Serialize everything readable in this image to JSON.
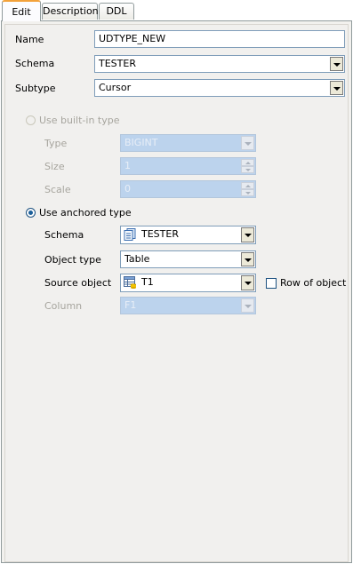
{
  "tabs": [
    {
      "label": "Edit"
    },
    {
      "label": "Description"
    },
    {
      "label": "DDL"
    }
  ],
  "general": {
    "name_label": "Name",
    "name_value": "UDTYPE_NEW",
    "schema_label": "Schema",
    "schema_value": "TESTER",
    "subtype_label": "Subtype",
    "subtype_value": "Cursor"
  },
  "builtin": {
    "radio_label": "Use built-in type",
    "type_label": "Type",
    "type_value": "BIGINT",
    "size_label": "Size",
    "size_value": "1",
    "scale_label": "Scale",
    "scale_value": "0"
  },
  "anchored": {
    "radio_label": "Use anchored type",
    "schema_label": "Schema",
    "schema_value": "TESTER",
    "object_type_label": "Object type",
    "object_type_value": "Table",
    "source_object_label": "Source object",
    "source_object_value": "T1",
    "row_of_object_label": "Row of object",
    "column_label": "Column",
    "column_value": "F1"
  }
}
